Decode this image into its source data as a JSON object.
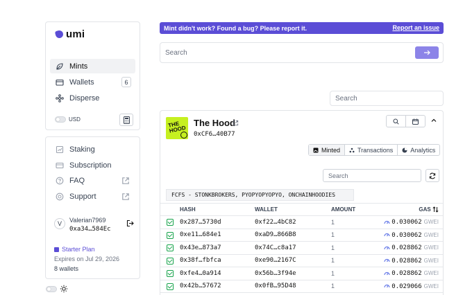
{
  "app": {
    "name": "umi",
    "brand_color": "#5b4dd6"
  },
  "sidebar": {
    "items": [
      {
        "label": "Mints",
        "icon": "leaf-icon",
        "active": true
      },
      {
        "label": "Wallets",
        "icon": "wallet-icon",
        "badge": "6"
      },
      {
        "label": "Disperse",
        "icon": "disperse-icon"
      }
    ],
    "currency_label": "USD",
    "secondary_items": [
      {
        "label": "Staking",
        "icon": "staking-icon"
      },
      {
        "label": "Subscription",
        "icon": "card-icon"
      },
      {
        "label": "FAQ",
        "icon": "help-icon"
      },
      {
        "label": "Support",
        "icon": "support-icon"
      }
    ],
    "user": {
      "avatar_letter": "V",
      "name": "Valerian7969",
      "address": "0xa34…584Ec"
    },
    "plan": {
      "name": "Starter Plan",
      "expires": "Expires on Jul 29, 2026",
      "wallets": "8 wallets"
    }
  },
  "banner": {
    "text": "Mint didn't work? Found a bug? Please report it.",
    "link": "Report an issue"
  },
  "search": {
    "placeholder": "Search"
  },
  "filter_search": {
    "placeholder": "Search"
  },
  "collection": {
    "image_text": "THE HOOD",
    "title": "The Hood",
    "address": "0xCF6…40B77",
    "tabs": [
      {
        "label": "Minted",
        "icon": "image-icon",
        "active": true
      },
      {
        "label": "Transactions",
        "icon": "transactions-icon"
      },
      {
        "label": "Analytics",
        "icon": "pie-chart-icon"
      }
    ],
    "inner_search_placeholder": "Search",
    "filter": "FCFS - STONKBROKERS, PYOPYOPYOPYO, ONCHAINHOODIES",
    "columns": {
      "hash": "HASH",
      "wallet": "WALLET",
      "amount": "AMOUNT",
      "gas": "GAS"
    },
    "rows": [
      {
        "hash": "0x287…5730d",
        "wallet": "0xf22…4bC82",
        "amount": "1",
        "gas": "0.030062",
        "unit": "GWEI"
      },
      {
        "hash": "0xe11…684e1",
        "wallet": "0xaD9…866B8",
        "amount": "1",
        "gas": "0.030062",
        "unit": "GWEI"
      },
      {
        "hash": "0x43e…873a7",
        "wallet": "0x74C…c8a17",
        "amount": "1",
        "gas": "0.028862",
        "unit": "GWEI"
      },
      {
        "hash": "0x38f…fbfca",
        "wallet": "0xe90…2167C",
        "amount": "1",
        "gas": "0.028862",
        "unit": "GWEI"
      },
      {
        "hash": "0xfe4…0a914",
        "wallet": "0x56b…3f94e",
        "amount": "1",
        "gas": "0.028862",
        "unit": "GWEI"
      },
      {
        "hash": "0x42b…57672",
        "wallet": "0x0fB…95D48",
        "amount": "1",
        "gas": "0.029066",
        "unit": "GWEI"
      }
    ]
  }
}
